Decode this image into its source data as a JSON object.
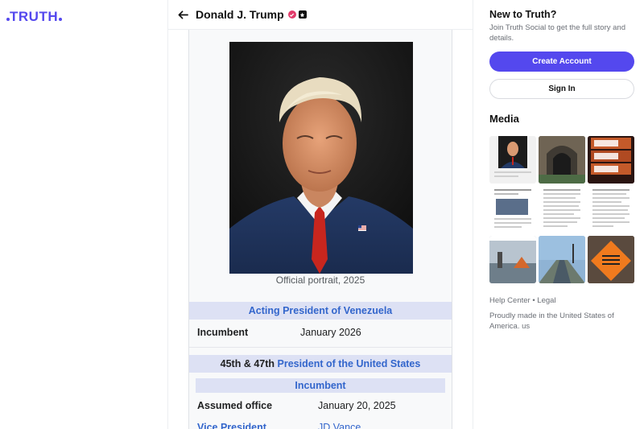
{
  "brand": {
    "logo_text": "TRUTH",
    "accent": "#5448ee"
  },
  "header": {
    "back_icon": "arrow-left-icon",
    "name": "Donald J. Trump",
    "badges": [
      "verified-icon",
      "gold-badge-icon"
    ]
  },
  "post_image": {
    "caption": "Official portrait, 2025",
    "section_acting": "Acting President of Venezuela",
    "incumbent_label": "Incumbent",
    "incumbent_value": "January 2026",
    "section_president_prefix": "45th & 47th",
    "section_president_link": "President of the United States",
    "incumbent_sub": "Incumbent",
    "assumed_label": "Assumed office",
    "assumed_value": "January 20, 2025",
    "vp_label": "Vice President",
    "vp_value": "JD Vance"
  },
  "sidebar": {
    "new_title": "New to Truth?",
    "new_sub": "Join Truth Social to get the full story and details.",
    "create_label": "Create Account",
    "signin_label": "Sign In",
    "media_title": "Media",
    "footer_links": "Help Center • Legal",
    "footer_made": "Proudly made in the United States of America. us"
  }
}
